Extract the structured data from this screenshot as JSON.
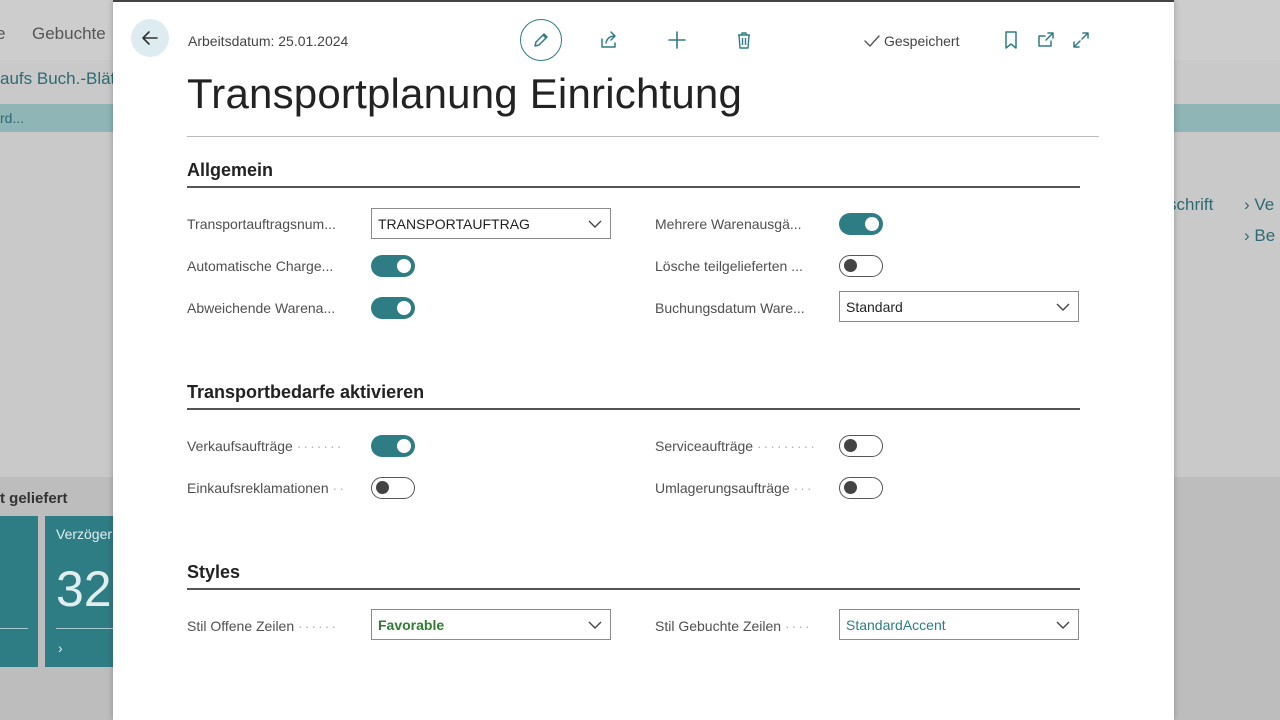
{
  "background": {
    "nav_item": "Gebuchte",
    "nav_item_left": "e",
    "link_text": "aufs Buch.-Blät",
    "band_text": "rd...",
    "right_heading": "schrift",
    "right_links": [
      "Ve",
      "Be"
    ],
    "late_label": "t geliefert",
    "tile_label": "Verzöger",
    "tile_value": "32"
  },
  "header": {
    "work_date": "Arbeitsdatum: 25.01.2024",
    "saved_label": "Gespeichert"
  },
  "page_title": "Transportplanung Einrichtung",
  "sections": {
    "general": {
      "title": "Allgemein",
      "transport_order_nos": {
        "label": "Transportauftragsnum...",
        "value": "TRANSPORTAUFTRAG"
      },
      "auto_batch": {
        "label": "Automatische Charge...",
        "on": true
      },
      "diff_goods": {
        "label": "Abweichende Warena...",
        "on": true
      },
      "multiple_goods_out": {
        "label": "Mehrere Warenausgä...",
        "on": true
      },
      "delete_partial": {
        "label": "Lösche teilgelieferten ...",
        "on": false
      },
      "posting_date": {
        "label": "Buchungsdatum Ware...",
        "value": "Standard"
      }
    },
    "demand": {
      "title": "Transportbedarfe aktivieren",
      "sales_orders": {
        "label": "Verkaufsaufträge",
        "on": true
      },
      "purchase_returns": {
        "label": "Einkaufsreklamationen",
        "on": false
      },
      "service_orders": {
        "label": "Serviceaufträge",
        "on": false
      },
      "transfer_orders": {
        "label": "Umlagerungsaufträge",
        "on": false
      }
    },
    "styles": {
      "title": "Styles",
      "open_lines": {
        "label": "Stil Offene Zeilen",
        "value": "Favorable"
      },
      "posted_lines": {
        "label": "Stil Gebuchte Zeilen",
        "value": "StandardAccent"
      }
    }
  },
  "colors": {
    "accent": "#2f7d84",
    "favorable": "#2e7d32"
  }
}
